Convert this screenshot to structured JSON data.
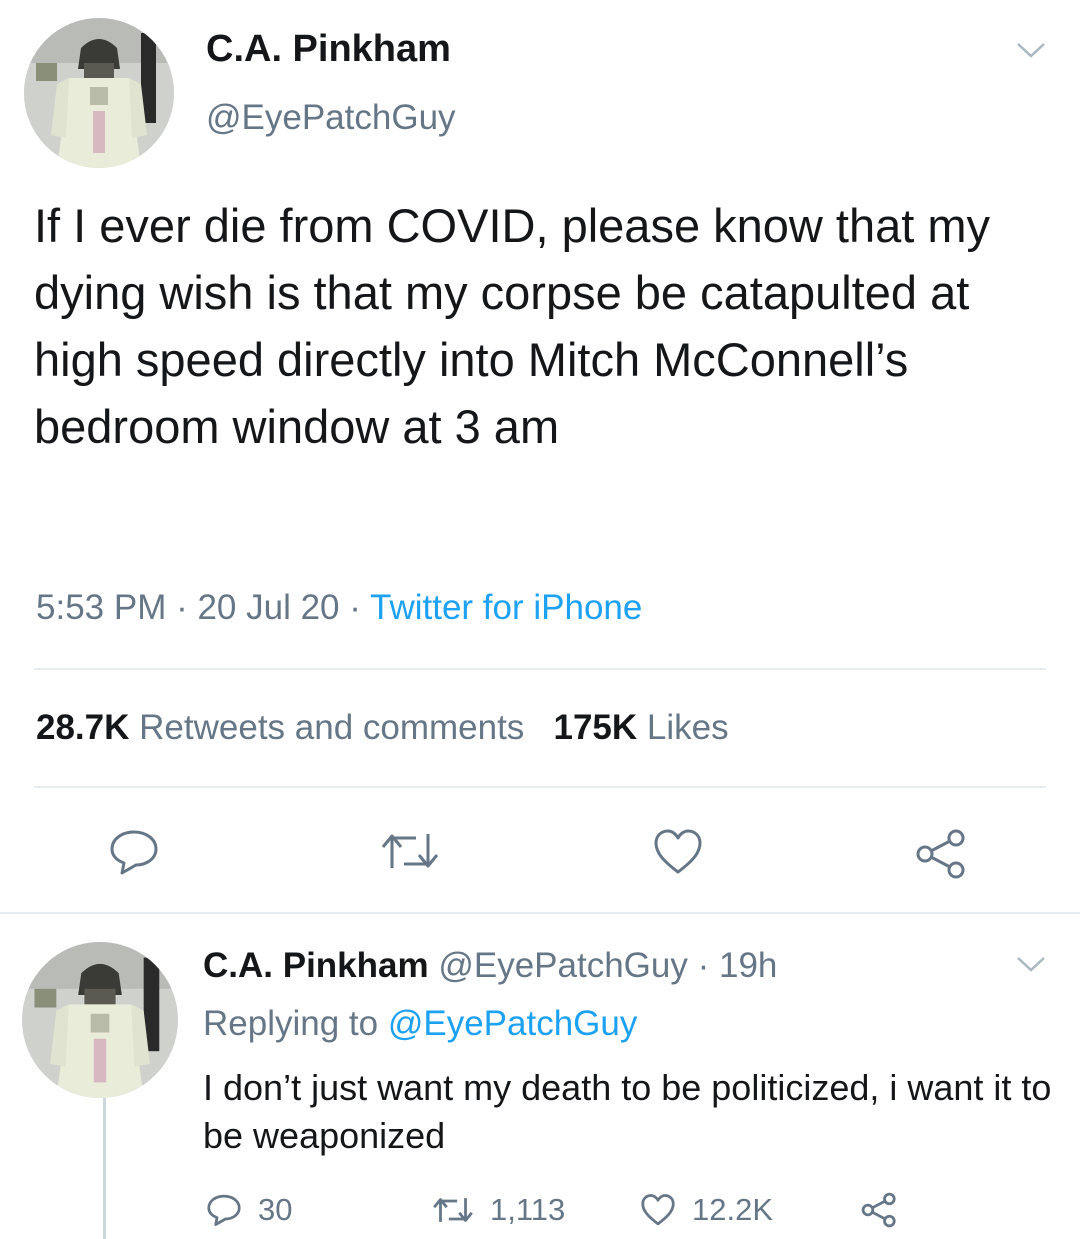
{
  "tweet": {
    "author_name": "C.A. Pinkham",
    "author_handle": "@EyePatchGuy",
    "text": "If I ever die from COVID, please know that my dying wish is that my corpse be catapulted at high speed directly into Mitch McConnell’s bedroom window at 3 am",
    "time": "5:53 PM",
    "date": "20 Jul 20",
    "separator": " · ",
    "source": "Twitter for iPhone",
    "retweets_count": "28.7K",
    "retweets_label": "Retweets and comments",
    "likes_count": "175K",
    "likes_label": "Likes"
  },
  "reply": {
    "author_name": "C.A. Pinkham",
    "author_handle": "@EyePatchGuy",
    "age": "19h",
    "separator": " · ",
    "replying_prefix": "Replying to ",
    "replying_to": "@EyePatchGuy",
    "text": "I don’t just want my death to be politicized, i want it to be weaponized",
    "reply_count": "30",
    "retweet_count": "1,113",
    "like_count": "12.2K"
  },
  "icons": {
    "avatar": "avatar-image",
    "chevron": "chevron-down-icon",
    "reply": "reply-icon",
    "retweet": "retweet-icon",
    "like": "heart-icon",
    "share": "share-icon"
  },
  "colors": {
    "text": "#14171a",
    "secondary": "#657786",
    "link": "#1da1f2",
    "divider": "#e6ecf0"
  }
}
